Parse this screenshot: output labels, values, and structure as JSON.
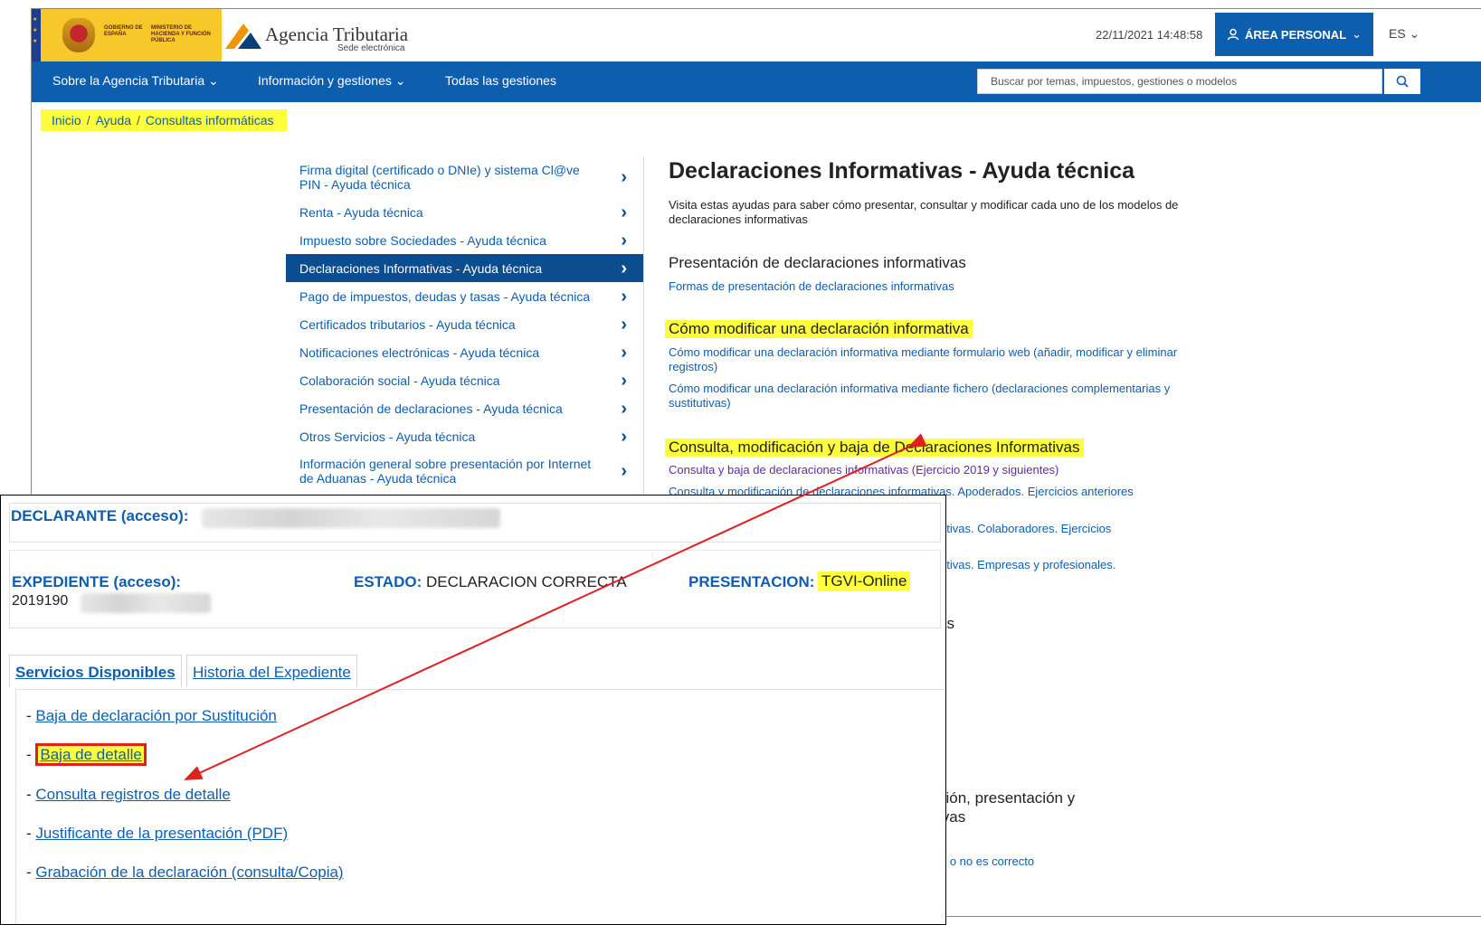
{
  "header": {
    "gov_logo_line1": "GOBIERNO DE ESPAÑA",
    "gov_logo_line2": "MINISTERIO DE HACIENDA Y FUNCIÓN PÚBLICA",
    "agency_name": "Agencia Tributaria",
    "agency_subtitle": "Sede electrónica",
    "datetime": "22/11/2021 14:48:58",
    "area_personal": "ÁREA PERSONAL",
    "language": "ES",
    "brand_color": "#0d5eaf"
  },
  "nav": {
    "items": [
      "Sobre la Agencia Tributaria",
      "Información y gestiones",
      "Todas las gestiones"
    ],
    "search_placeholder": "Buscar por temas, impuestos, gestiones o modelos"
  },
  "breadcrumb": [
    "Inicio",
    "Ayuda",
    "Consultas informáticas"
  ],
  "sidebar": {
    "items": [
      {
        "label": "Firma digital (certificado o DNIe) y sistema Cl@ve PIN - Ayuda técnica",
        "active": false
      },
      {
        "label": "Renta - Ayuda técnica",
        "active": false
      },
      {
        "label": "Impuesto sobre Sociedades - Ayuda técnica",
        "active": false
      },
      {
        "label": "Declaraciones Informativas - Ayuda técnica",
        "active": true
      },
      {
        "label": "Pago de impuestos, deudas y tasas - Ayuda técnica",
        "active": false
      },
      {
        "label": "Certificados tributarios - Ayuda técnica",
        "active": false
      },
      {
        "label": "Notificaciones electrónicas - Ayuda técnica",
        "active": false
      },
      {
        "label": "Colaboración social - Ayuda técnica",
        "active": false
      },
      {
        "label": "Presentación de declaraciones - Ayuda técnica",
        "active": false
      },
      {
        "label": "Otros Servicios - Ayuda técnica",
        "active": false
      },
      {
        "label": "Información general sobre presentación por Internet de Aduanas - Ayuda técnica",
        "active": false
      }
    ]
  },
  "content": {
    "title": "Declaraciones Informativas - Ayuda técnica",
    "intro": "Visita estas ayudas para saber cómo presentar, consultar y modificar cada uno de los modelos de declaraciones informativas",
    "sections": [
      {
        "title": "Presentación de declaraciones informativas",
        "links": [
          "Formas de presentación de declaraciones informativas"
        ]
      },
      {
        "title": "Cómo modificar una declaración informativa",
        "links": [
          "Cómo modificar una declaración informativa mediante formulario web (añadir, modificar y eliminar registros)",
          "Cómo modificar una declaración informativa mediante fichero (declaraciones complementarias y sustitutivas)"
        ]
      },
      {
        "title": "Consulta, modificación y baja de Declaraciones Informativas",
        "links": [
          "Consulta y baja de declaraciones informativas (Ejercicio 2019 y siguientes)",
          "Consulta y modificación de declaraciones informativas. Apoderados. Ejercicios anteriores"
        ]
      }
    ],
    "partial_fragments": [
      "ativas. Colaboradores. Ejercicios",
      "ativas. Empresas y profesionales.",
      "as",
      "ción, presentación y",
      "ivas",
      "o o no es correcto"
    ]
  },
  "panel": {
    "declarante_label": "DECLARANTE (acceso):",
    "expediente_label": "EXPEDIENTE (acceso):",
    "expediente_value": "2019190",
    "estado_label": "ESTADO:",
    "estado_value": "DECLARACION CORRECTA",
    "presentacion_label": "PRESENTACION:",
    "presentacion_value": "TGVI-Online",
    "tabs": [
      "Servicios Disponibles",
      "Historia del Expediente"
    ],
    "services": [
      "Baja de declaración por Sustitución",
      "Baja de detalle",
      "Consulta registros de detalle",
      "Justificante de la presentación (PDF)",
      "Grabación de la declaración (consulta/Copia)"
    ],
    "highlighted_service_index": 1,
    "highlight_color": "#ffff3b",
    "annotation_color": "#e02020"
  }
}
